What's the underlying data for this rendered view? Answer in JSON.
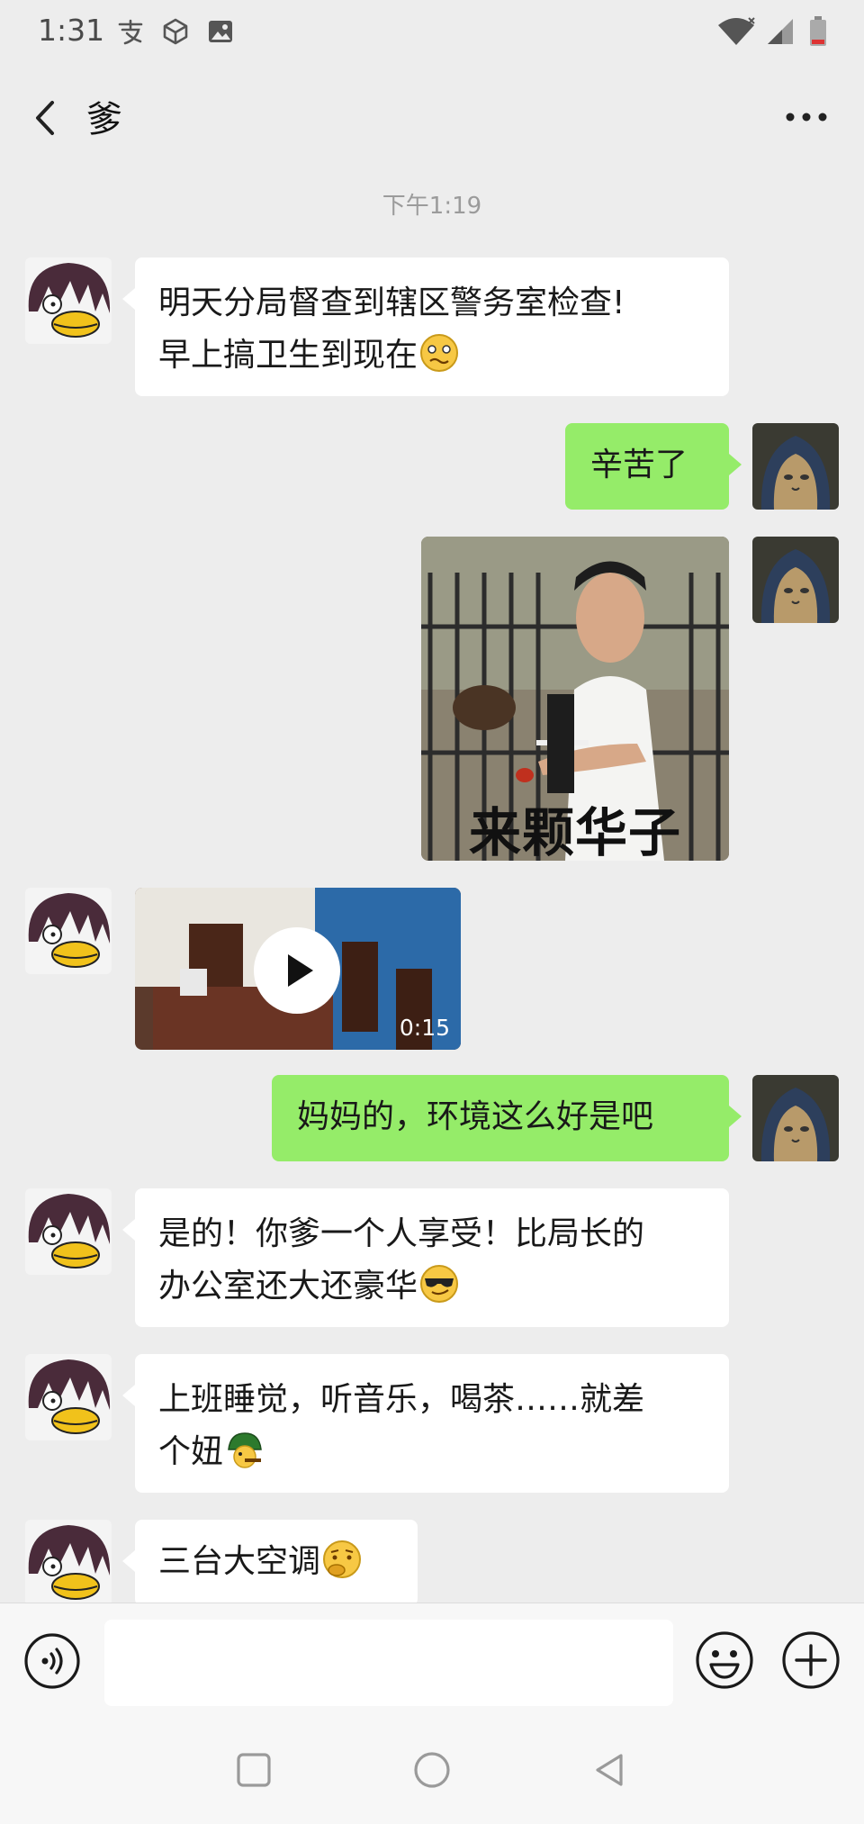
{
  "status_bar": {
    "time": "1:31"
  },
  "header": {
    "title": "爹"
  },
  "chat": {
    "timestamp": "下午1:19",
    "messages": [
      {
        "side": "left",
        "lines": [
          "明天分局督查到辖区警务室检查!",
          "早上搞卫生到现在"
        ],
        "emoji": "woozy-face-emoji"
      },
      {
        "side": "right",
        "lines": [
          "辛苦了"
        ]
      },
      {
        "side": "right",
        "type": "sticker",
        "caption": "来颗华子"
      },
      {
        "side": "left",
        "type": "video",
        "duration": "0:15"
      },
      {
        "side": "right",
        "lines": [
          "妈妈的，环境这么好是吧"
        ]
      },
      {
        "side": "left",
        "lines": [
          "是的！你爹一个人享受！比局长的",
          "办公室还大还豪华"
        ],
        "emoji": "sunglasses-emoji"
      },
      {
        "side": "left",
        "lines": [
          "上班睡觉，听音乐，喝茶……就差",
          "个妞"
        ],
        "emoji": "cigar-turtle-emoji"
      },
      {
        "side": "left",
        "lines": [
          "三台大空调"
        ],
        "emoji": "thinking-emoji"
      }
    ]
  },
  "colors": {
    "background": "#ededed",
    "bubble_sent": "#95ec69",
    "bubble_received": "#ffffff"
  }
}
